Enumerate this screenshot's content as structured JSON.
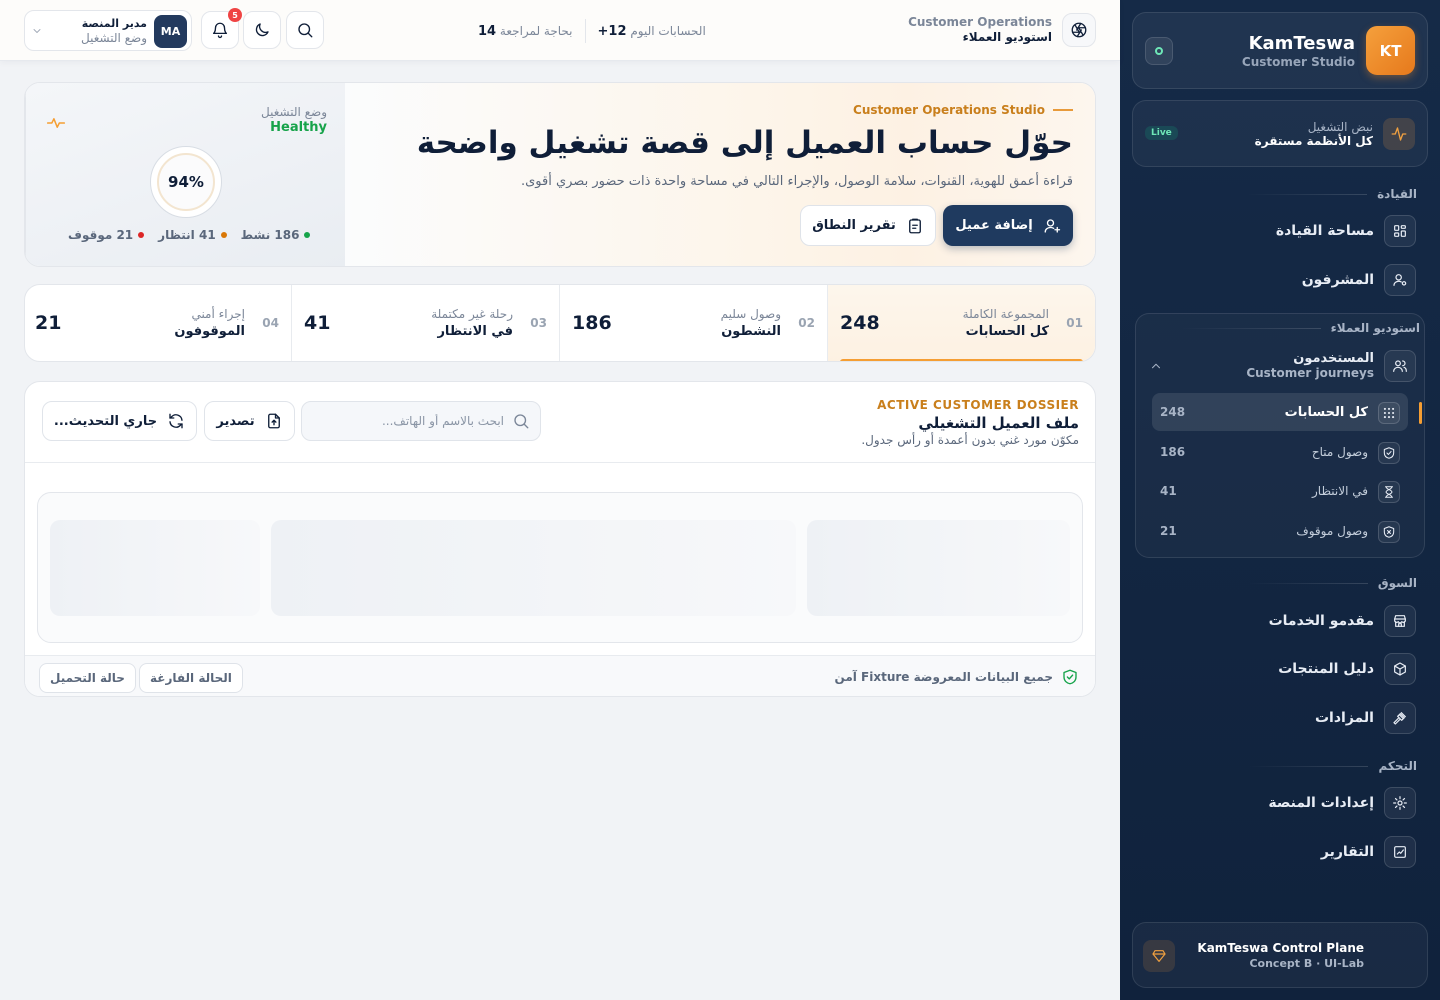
{
  "sidebar": {
    "brand": {
      "logo": "KT",
      "name": "KamTeswa",
      "subtitle": "Customer Studio"
    },
    "pulse": {
      "title": "نبض التشغيل",
      "subtitle": "كل الأنظمة مستقرة",
      "badge": "Live"
    },
    "sections": {
      "leadership": "القيادة",
      "studio": "استوديو العملاء",
      "market": "السوق",
      "control": "التحكم"
    },
    "nav": {
      "command_space": "مساحة القيادة",
      "supervisors": "المشرفون",
      "providers": "مقدمو الخدمات",
      "catalog": "دليل المنتجات",
      "auctions": "المزادات",
      "settings": "إعدادات المنصة",
      "reports": "التقارير"
    },
    "users": {
      "title": "المستخدمون",
      "subtitle": "Customer journeys"
    },
    "sub_items": [
      {
        "label": "كل الحسابات",
        "count": "248"
      },
      {
        "label": "وصول متاح",
        "count": "186"
      },
      {
        "label": "في الانتظار",
        "count": "41"
      },
      {
        "label": "وصول موقوف",
        "count": "21"
      }
    ],
    "footer": {
      "title": "KamTeswa Control Plane",
      "subtitle": "Concept B · UI-Lab"
    }
  },
  "topbar": {
    "title": "Customer Operations",
    "subtitle": "استوديو العملاء",
    "stats": {
      "today_label": "الحسابات اليوم",
      "today_value": "+12",
      "review_label": "بحاجة لمراجعة",
      "review_value": "14"
    },
    "notifications_count": "5",
    "profile": {
      "initials": "MA",
      "name": "مدير المنصة",
      "role": "وضع التشغيل"
    }
  },
  "hero": {
    "eyebrow": "Customer Operations Studio",
    "heading": "حوّل حساب العميل إلى قصة تشغيل واضحة",
    "description": "قراءة أعمق للهوية، القنوات، سلامة الوصول، والإجراء التالي في مساحة واحدة ذات حضور بصري أقوى.",
    "primary_button": "إضافة عميل",
    "secondary_button": "تقرير النطاق",
    "ops": {
      "label": "وضع التشغيل",
      "value": "Healthy",
      "gauge": "94%",
      "legend": [
        {
          "text": "186 نشط",
          "color": "#16a34a"
        },
        {
          "text": "41 انتظار",
          "color": "#d97706"
        },
        {
          "text": "21 موقوف",
          "color": "#dc2626"
        }
      ]
    }
  },
  "tabs": [
    {
      "num": "01",
      "small": "المجموعة الكاملة",
      "label": "كل الحسابات",
      "count": "248",
      "active": true
    },
    {
      "num": "02",
      "small": "وصول سليم",
      "label": "النشطون",
      "count": "186",
      "active": false
    },
    {
      "num": "03",
      "small": "رحلة غير مكتملة",
      "label": "في الانتظار",
      "count": "41",
      "active": false
    },
    {
      "num": "04",
      "small": "إجراء أمني",
      "label": "الموقوفون",
      "count": "21",
      "active": false
    }
  ],
  "dossier": {
    "eyebrow": "ACTIVE CUSTOMER DOSSIER",
    "title": "ملف العميل التشغيلي",
    "subtitle": "مكوّن مورد غني بدون أعمدة أو رأس جدول.",
    "search_placeholder": "ابحث بالاسم أو الهاتف...",
    "export_label": "تصدير",
    "refresh_label": "جاري التحديث...",
    "footer_text": "جميع البيانات المعروضة Fixture آمن",
    "empty_state": "الحالة الفارغة",
    "loading_state": "حالة التحميل"
  }
}
